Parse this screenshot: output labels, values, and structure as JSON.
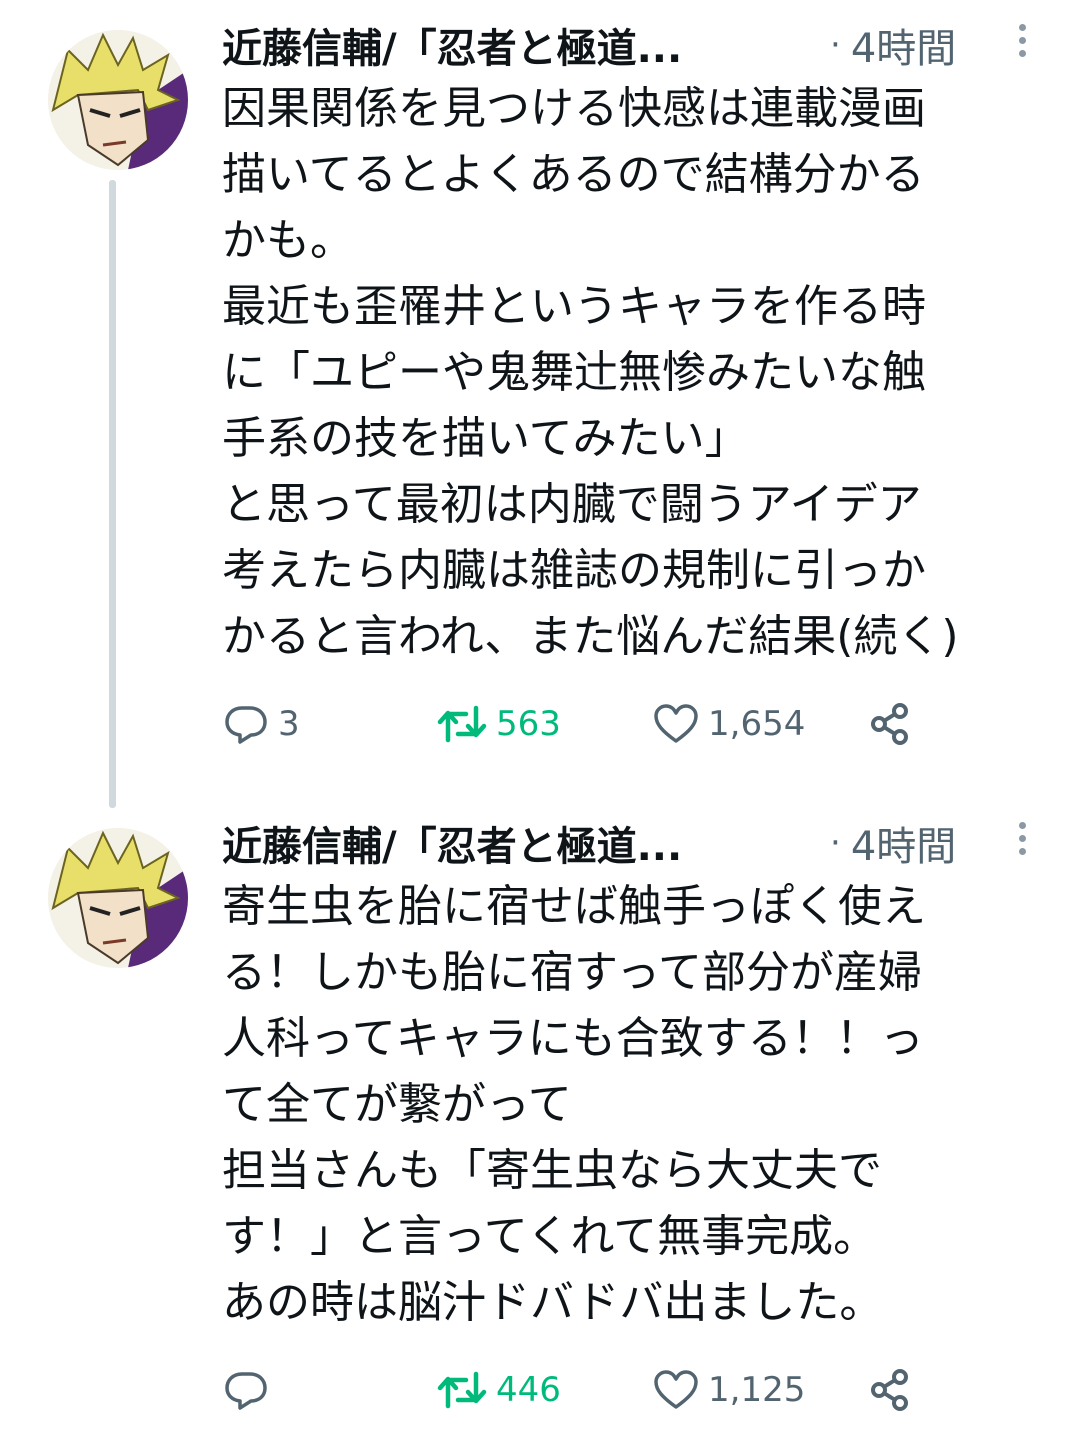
{
  "tweets": [
    {
      "author": "近藤信輔/「忍者と極道...",
      "separator": "·",
      "time": "4時間",
      "lines": [
        "因果関係を見つける快感は連載漫画",
        "描いてるとよくあるので結構分かる",
        "かも。",
        "最近も歪罹井というキャラを作る時",
        "に「ユピーや鬼舞辻無惨みたいな触",
        "手系の技を描いてみたい」",
        "と思って最初は内臓で闘うアイデア",
        "考えたら内臓は雑誌の規制に引っか",
        "かると言われ、また悩んだ結果(続く)"
      ],
      "replies": "3",
      "retweets": "563",
      "likes": "1,654"
    },
    {
      "author": "近藤信輔/「忍者と極道...",
      "separator": "·",
      "time": "4時間",
      "lines": [
        "寄生虫を胎に宿せば触手っぽく使え",
        "る！しかも胎に宿すって部分が産婦",
        "人科ってキャラにも合致する！！っ",
        "て全てが繋がって",
        "担当さんも「寄生虫なら大丈夫で",
        "す！」と言ってくれて無事完成。",
        "あの時は脳汁ドバドバ出ました。"
      ],
      "replies": "",
      "retweets": "446",
      "likes": "1,125"
    }
  ],
  "icons": {
    "reply": "reply-icon",
    "retweet": "retweet-icon",
    "like": "heart-icon",
    "share": "share-icon",
    "more": "more-vertical-icon"
  },
  "colors": {
    "text": "#0f1419",
    "muted": "#536471",
    "retweet_green": "#00ba7c",
    "thread_line": "#cfd9de"
  }
}
